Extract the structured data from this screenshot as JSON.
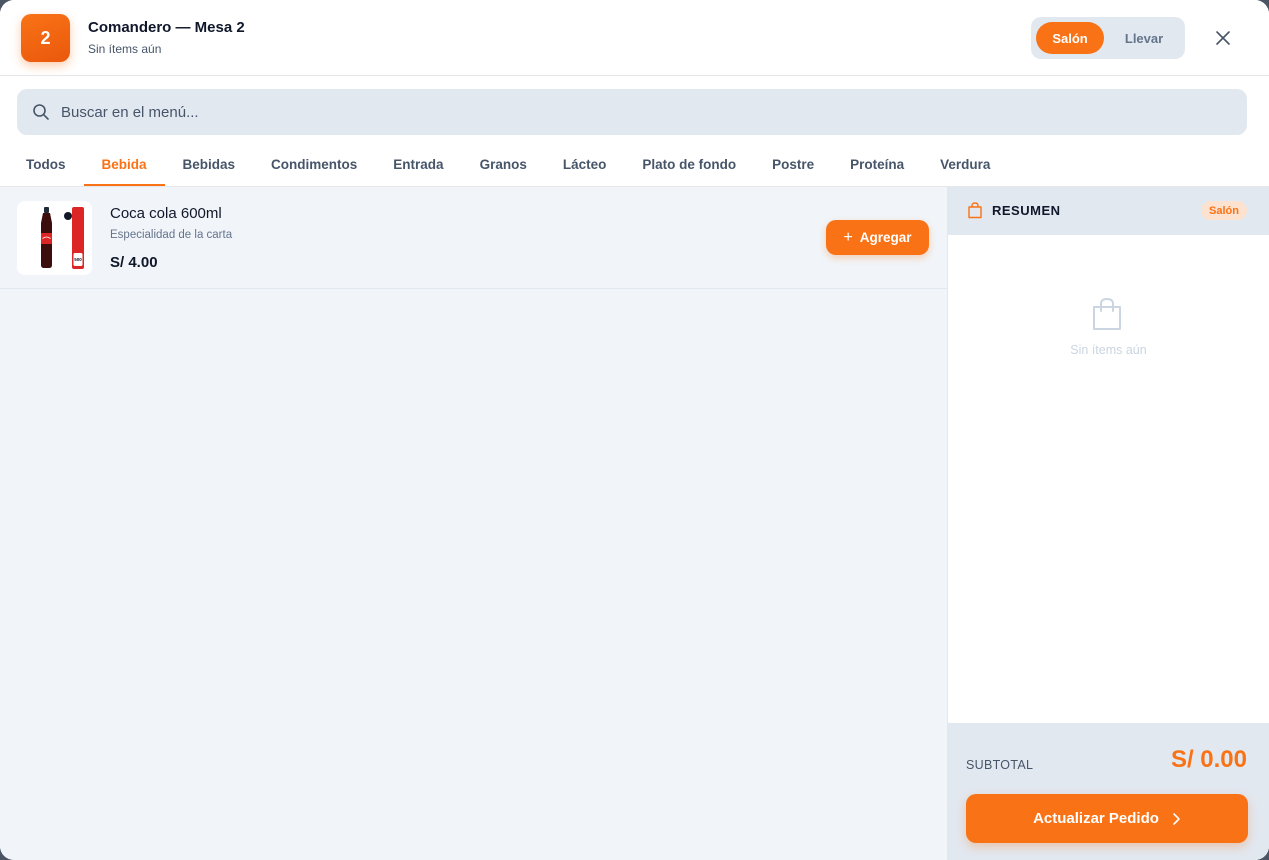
{
  "header": {
    "table_number": "2",
    "title": "Comandero — Mesa 2",
    "subtitle": "Sin ítems aún",
    "mode_options": [
      "Salón",
      "Llevar"
    ],
    "mode_selected": "Salón"
  },
  "search": {
    "placeholder": "Buscar en el menú..."
  },
  "tabs": {
    "items": [
      "Todos",
      "Bebida",
      "Bebidas",
      "Condimentos",
      "Entrada",
      "Granos",
      "Lácteo",
      "Plato de fondo",
      "Postre",
      "Proteína",
      "Verdura"
    ],
    "active": "Bebida"
  },
  "menu": {
    "items": [
      {
        "name": "Coca cola 600ml",
        "description": "Especialidad de la carta",
        "price": "S/ 4.00",
        "add_label": "Agregar",
        "thumb_label": "500"
      }
    ]
  },
  "summary": {
    "title": "RESUMEN",
    "mode_badge": "Salón",
    "empty_text": "Sin ítems aún",
    "subtotal_label": "SUBTOTAL",
    "subtotal_value": "S/ 0.00",
    "submit_label": "Actualizar Pedido"
  },
  "colors": {
    "accent": "#f97316",
    "panel_bg": "#e2e8f0",
    "list_bg": "#f1f5f9"
  },
  "icons": {
    "search": "search-icon",
    "close": "close-icon",
    "bag": "shopping-bag-icon",
    "plus": "plus-icon",
    "chevron": "chevron-right-icon"
  }
}
